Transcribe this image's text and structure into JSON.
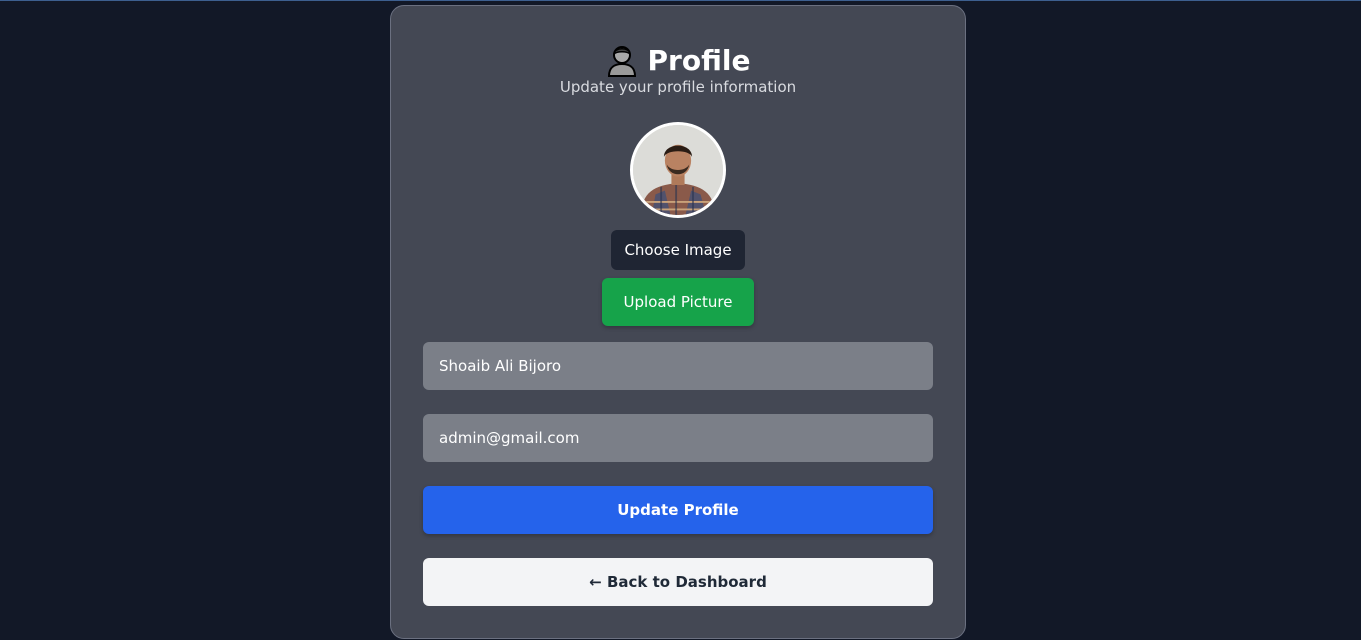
{
  "header": {
    "title": "Profile",
    "subtitle": "Update your profile information",
    "title_icon": "person-icon"
  },
  "avatar": {
    "icon": "avatar"
  },
  "buttons": {
    "choose_image": "Choose Image",
    "upload_picture": "Upload Picture",
    "update_profile": "Update Profile",
    "back_to_dashboard": "← Back to Dashboard"
  },
  "form": {
    "name_value": "Shoaib Ali Bijoro",
    "email_value": "admin@gmail.com"
  },
  "colors": {
    "background": "#121827",
    "card": "#444854",
    "upload_green": "#16a34a",
    "update_blue": "#2563eb",
    "back_light": "#f3f4f6",
    "choose_dark": "#1f2533"
  }
}
